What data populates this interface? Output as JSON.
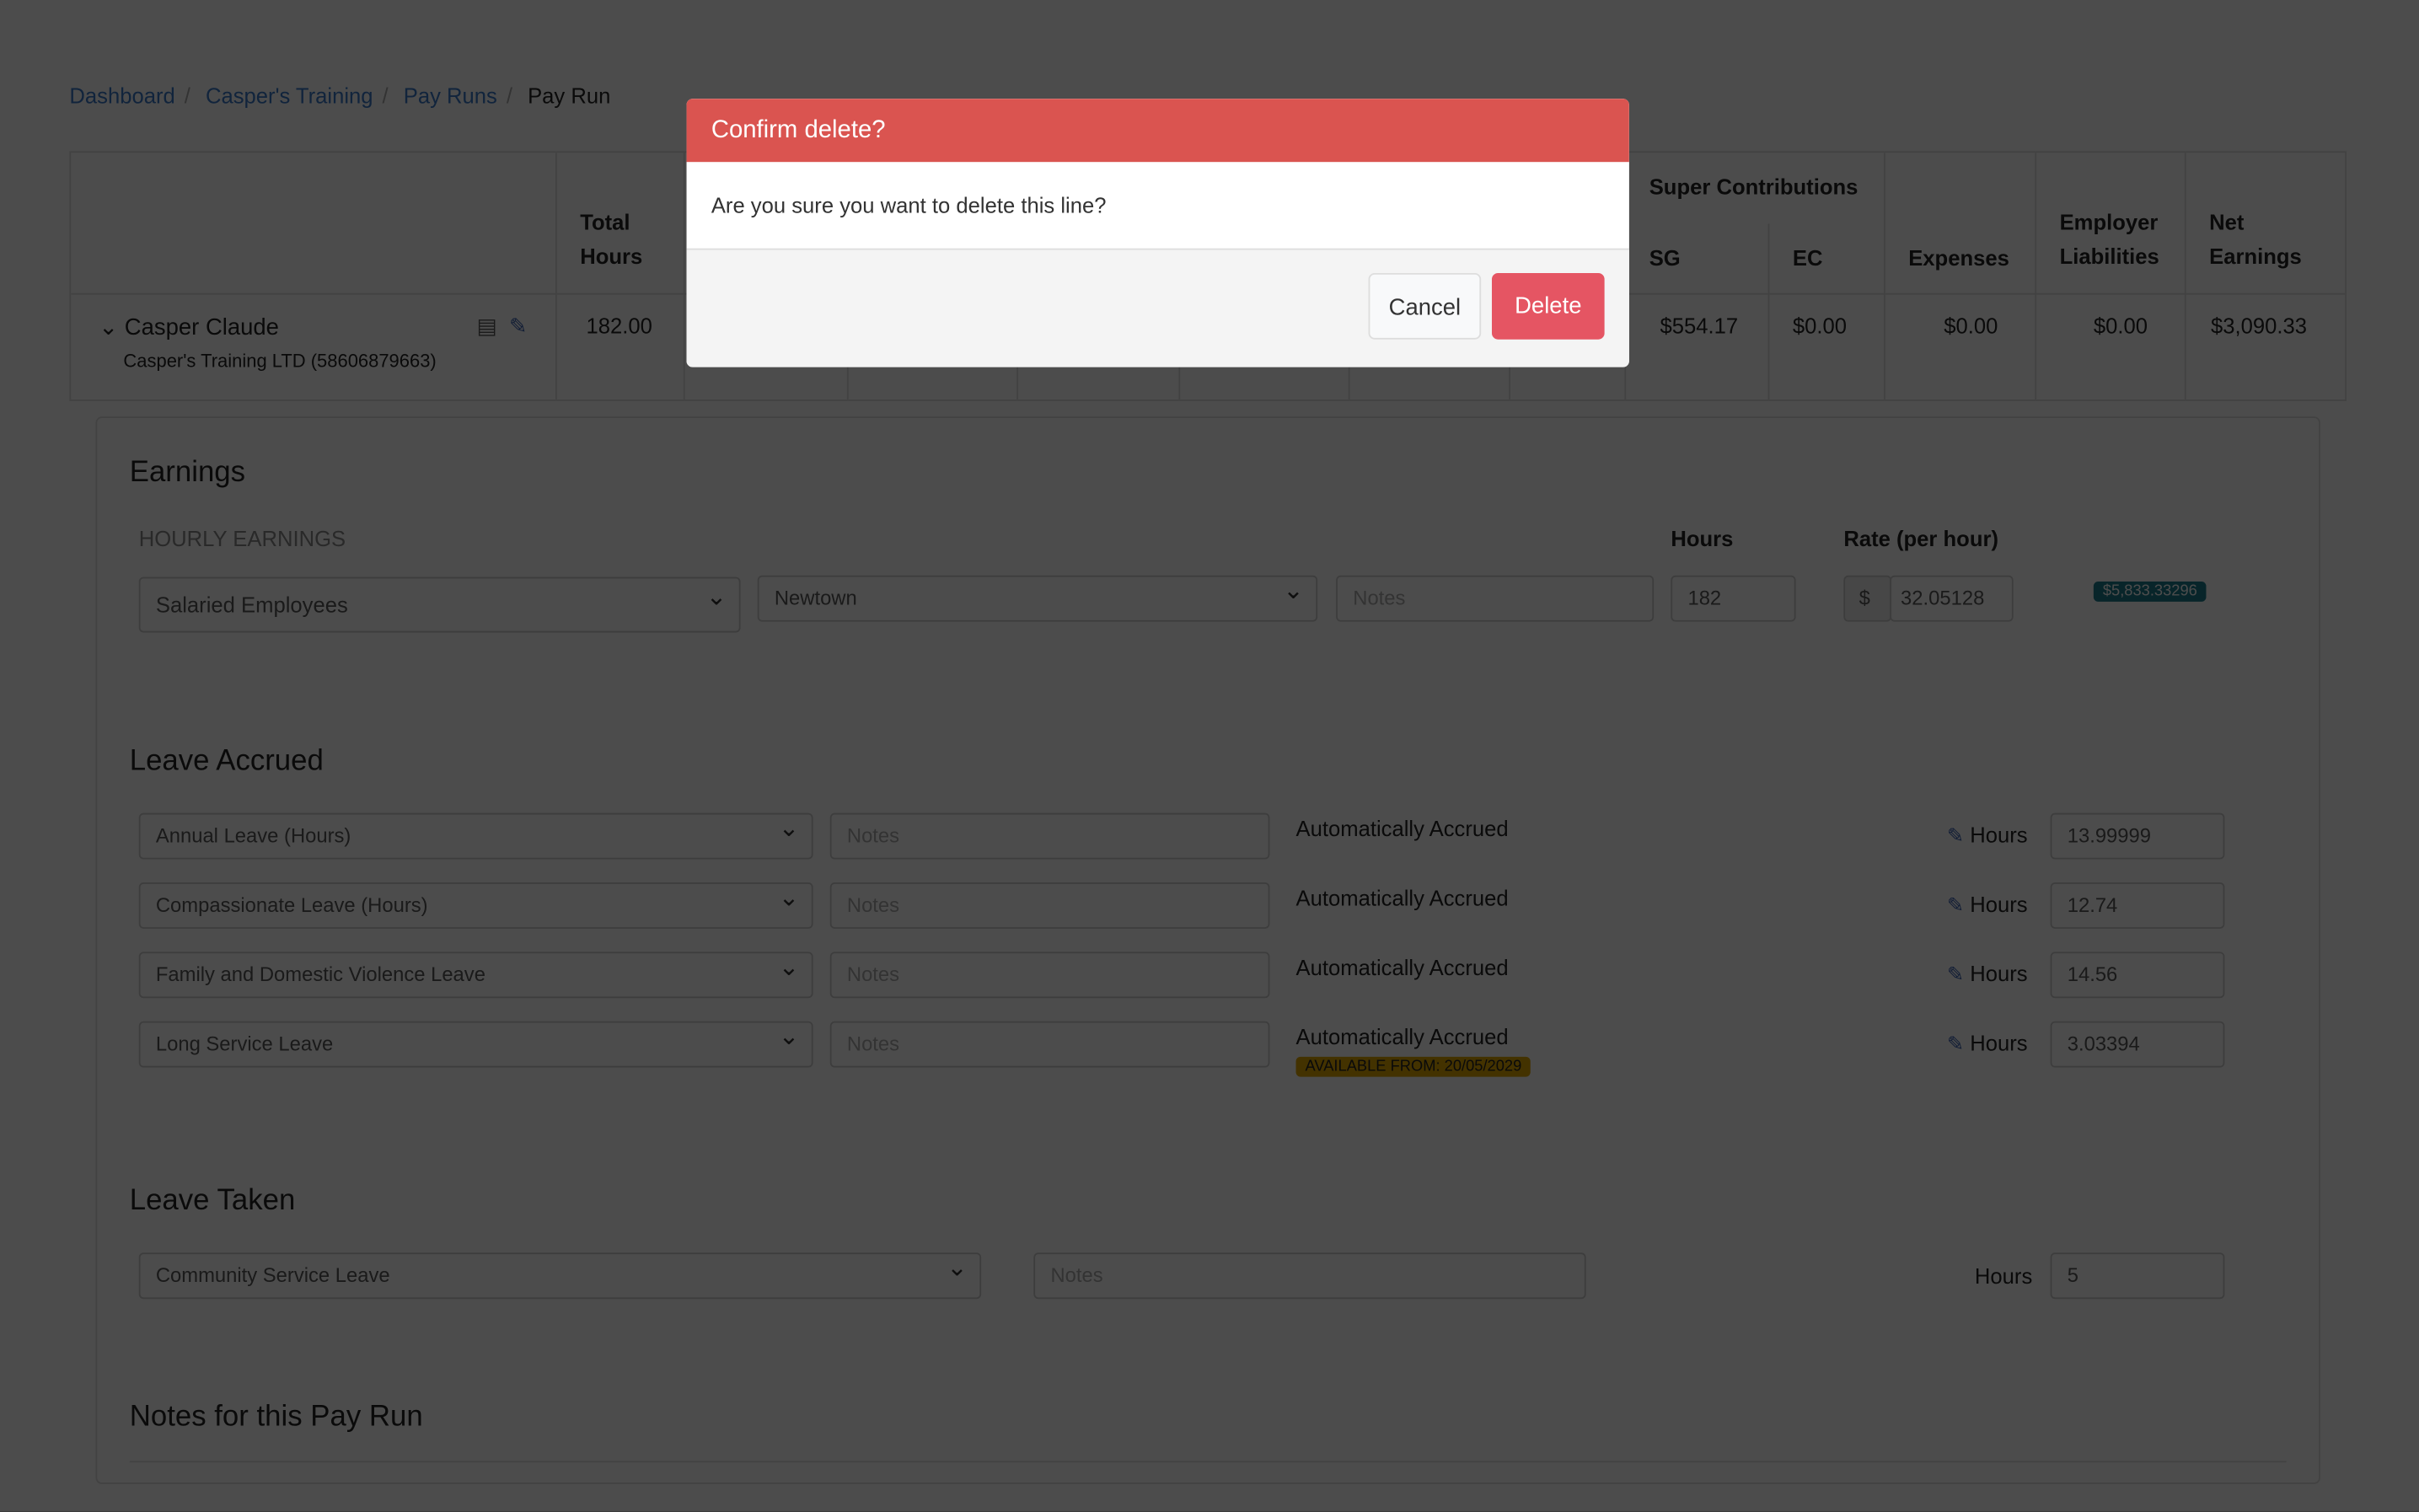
{
  "breadcrumb": [
    "Dashboard",
    "Casper's Training",
    "Pay Runs",
    "Pay Run"
  ],
  "table": {
    "headers": {
      "total_hours": "Total Hours",
      "super": "Super Contributions",
      "sg": "SG",
      "ec": "EC",
      "expenses": "Expenses",
      "employer": "Employer Liabilities",
      "net": "Net Earnings"
    },
    "row": {
      "name": "Casper Claude",
      "company": "Casper's Training LTD (58606879663)",
      "total_hours": "182.00",
      "sg": "$554.17",
      "ec": "$0.00",
      "expenses": "$0.00",
      "employer": "$0.00",
      "net": "$3,090.33"
    }
  },
  "earnings": {
    "title": "Earnings",
    "subtitle": "HOURLY EARNINGS",
    "hours_label": "Hours",
    "rate_label": "Rate (per hour)",
    "category": "Salaried Employees",
    "location": "Newtown",
    "notes_placeholder": "Notes",
    "hours": "182",
    "currency": "$",
    "rate": "32.05128",
    "total": "$5,833.33296"
  },
  "leave_accrued": {
    "title": "Leave Accrued",
    "items": [
      {
        "type": "Annual Leave (Hours)",
        "status": "Automatically Accrued",
        "hours": "13.99999"
      },
      {
        "type": "Compassionate Leave (Hours)",
        "status": "Automatically Accrued",
        "hours": "12.74"
      },
      {
        "type": "Family and Domestic Violence Leave",
        "status": "Automatically Accrued",
        "hours": "14.56"
      },
      {
        "type": "Long Service Leave",
        "status": "Automatically Accrued",
        "hours": "3.03394",
        "badge": "AVAILABLE FROM: 20/05/2029"
      }
    ],
    "hours_label": "Hours",
    "notes_placeholder": "Notes"
  },
  "leave_taken": {
    "title": "Leave Taken",
    "type": "Community Service Leave",
    "notes_placeholder": "Notes",
    "hours_label": "Hours",
    "hours": "5"
  },
  "notes": {
    "title": "Notes for this Pay Run"
  },
  "modal": {
    "title": "Confirm delete?",
    "message": "Are you sure you want to delete this line?",
    "cancel": "Cancel",
    "delete": "Delete"
  },
  "colors": {
    "modal_header": "#da5450",
    "delete_button": "#e55563",
    "link": "#3a78c9",
    "total_badge": "#1a7a8c",
    "available_badge": "#e0a800"
  }
}
